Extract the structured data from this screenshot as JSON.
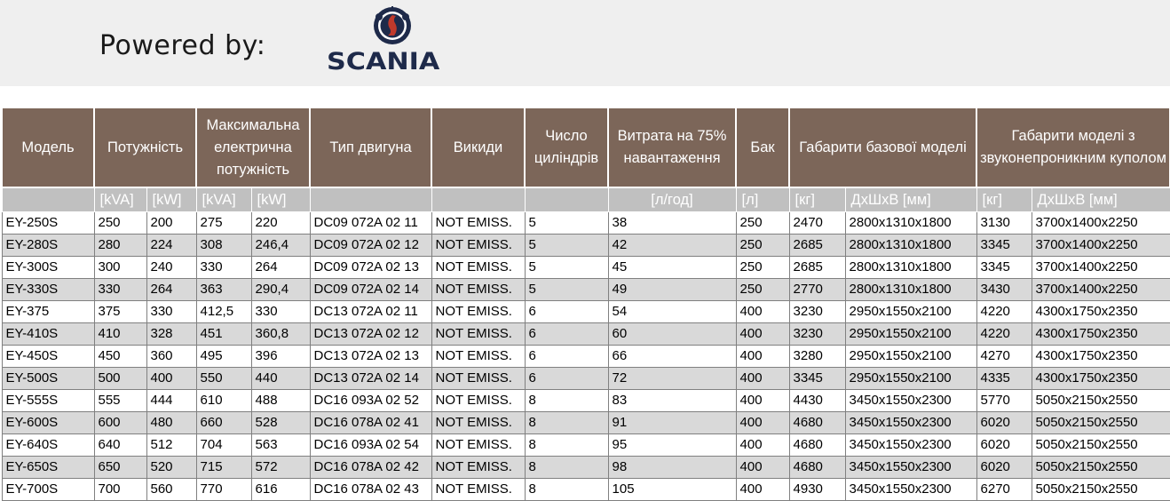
{
  "header": {
    "powered_by": "Powered by:",
    "brand": "SCANIA",
    "brand_color": "#1e2a4a"
  },
  "table": {
    "header_color": "#7c6659",
    "columns": {
      "model": "Модель",
      "power": "Потужність",
      "max_power": "Максимальна електрична потужність",
      "engine": "Тип двигуна",
      "emissions": "Викиди",
      "cylinders": "Число циліндрів",
      "consumption": "Витрата на 75% навантаження",
      "tank": "Бак",
      "dims_base": "Габарити базової моделі",
      "dims_canopy": "Габарити моделі з звуконепроникним куполом"
    },
    "units": [
      "[kVA]",
      "[kW]",
      "[kVA]",
      "[kW]",
      "[л/год]",
      "[л]",
      "[кг]",
      "ДхШхВ [мм]",
      "[кг]",
      "ДхШхВ [мм]"
    ],
    "rows": [
      [
        "EY-250S",
        "250",
        "200",
        "275",
        "220",
        "DC09 072A 02 11",
        "NOT EMISS.",
        "5",
        "38",
        "250",
        "2470",
        "2800x1310x1800",
        "3130",
        "3700x1400x2250"
      ],
      [
        "EY-280S",
        "280",
        "224",
        "308",
        "246,4",
        "DC09 072A 02 12",
        "NOT EMISS.",
        "5",
        "42",
        "250",
        "2685",
        "2800x1310x1800",
        "3345",
        "3700x1400x2250"
      ],
      [
        "EY-300S",
        "300",
        "240",
        "330",
        "264",
        "DC09 072A 02 13",
        "NOT EMISS.",
        "5",
        "45",
        "250",
        "2685",
        "2800x1310x1800",
        "3345",
        "3700x1400x2250"
      ],
      [
        "EY-330S",
        "330",
        "264",
        "363",
        "290,4",
        "DC09 072A 02 14",
        "NOT EMISS.",
        "5",
        "49",
        "250",
        "2770",
        "2800x1310x1800",
        "3430",
        "3700x1400x2250"
      ],
      [
        "EY-375",
        "375",
        "330",
        "412,5",
        "330",
        "DC13 072A 02 11",
        "NOT EMISS.",
        "6",
        "54",
        "400",
        "3230",
        "2950x1550x2100",
        "4220",
        "4300x1750x2350"
      ],
      [
        "EY-410S",
        "410",
        "328",
        "451",
        "360,8",
        "DC13 072A 02 12",
        "NOT EMISS.",
        "6",
        "60",
        "400",
        "3230",
        "2950x1550x2100",
        "4220",
        "4300x1750x2350"
      ],
      [
        "EY-450S",
        "450",
        "360",
        "495",
        "396",
        "DC13 072A 02 13",
        "NOT EMISS.",
        "6",
        "66",
        "400",
        "3280",
        "2950x1550x2100",
        "4270",
        "4300x1750x2350"
      ],
      [
        "EY-500S",
        "500",
        "400",
        "550",
        "440",
        "DC13 072A 02 14",
        "NOT EMISS.",
        "6",
        "72",
        "400",
        "3345",
        "2950x1550x2100",
        "4335",
        "4300x1750x2350"
      ],
      [
        "EY-555S",
        "555",
        "444",
        "610",
        "488",
        "DC16 093A 02 52",
        "NOT EMISS.",
        "8",
        "83",
        "400",
        "4430",
        "3450x1550x2300",
        "5770",
        "5050x2150x2550"
      ],
      [
        "EY-600S",
        "600",
        "480",
        "660",
        "528",
        "DC16 078A 02 41",
        "NOT EMISS.",
        "8",
        "91",
        "400",
        "4680",
        "3450x1550x2300",
        "6020",
        "5050x2150x2550"
      ],
      [
        "EY-640S",
        "640",
        "512",
        "704",
        "563",
        "DC16 093A 02 54",
        "NOT EMISS.",
        "8",
        "95",
        "400",
        "4680",
        "3450x1550x2300",
        "6020",
        "5050x2150x2550"
      ],
      [
        "EY-650S",
        "650",
        "520",
        "715",
        "572",
        "DC16 078A 02 42",
        "NOT EMISS.",
        "8",
        "98",
        "400",
        "4680",
        "3450x1550x2300",
        "6020",
        "5050x2150x2550"
      ],
      [
        "EY-700S",
        "700",
        "560",
        "770",
        "616",
        "DC16 078A 02 43",
        "NOT EMISS.",
        "8",
        "105",
        "400",
        "4930",
        "3450x1550x2300",
        "6270",
        "5050x2150x2550"
      ]
    ]
  }
}
